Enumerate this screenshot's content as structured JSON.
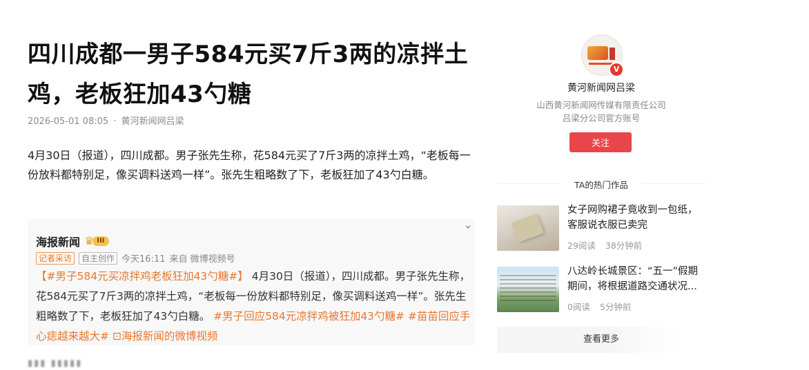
{
  "article": {
    "title": "四川成都一男子584元买7斤3两的凉拌土鸡，老板狂加43勺糖",
    "date": "2026-05-01 08:05",
    "meta_sep": "·",
    "source": "黄河新闻网吕梁",
    "body": "4月30日（报道），四川成都。男子张先生称，花584元买了7斤3两的凉拌土鸡，“老板每一份放料都特别足，像买调料送鸡一样”。张先生粗略数了下，老板狂加了43勺白糖。"
  },
  "embed": {
    "account": "海报新闻",
    "level": "III",
    "tags": [
      "记者采访",
      "自主创作"
    ],
    "time": "今天16:11",
    "from": "来自 微博视频号",
    "hashtag1": "【#男子584元买凉拌鸡老板狂加43勺糖#】",
    "text1": " 4月30日（报道），四川成都。男子张先生称，花584元买了7斤3两的凉拌土鸡，“老板每一份放料都特别足，像买调料送鸡一样”。张先生粗略数了下，老板狂加了43勺白糖。",
    "hashtag2": "#男子回应584元凉拌鸡被狂加43勺糖#",
    "hashtag3": "#苗苗回应手心痣越来越大#",
    "video_link": "⊡海报新闻的微博视频"
  },
  "sidebar": {
    "account_name": "黄河新闻网吕梁",
    "account_desc_line1": "山西黄河新闻网传媒有限责任公司",
    "account_desc_line2": "吕梁分公司官方账号",
    "follow_label": "关注",
    "section_title": "TA的热门作品",
    "works": [
      {
        "title": "女子网购裙子竟收到一包纸，客服说衣服已卖完",
        "reads": "29阅读",
        "time": "38分钟前"
      },
      {
        "title": "八达岭长城景区：“五一”假期期间，将根据道路交通状况...",
        "reads": "0阅读",
        "time": "5分钟前"
      }
    ],
    "more_label": "查看更多"
  }
}
